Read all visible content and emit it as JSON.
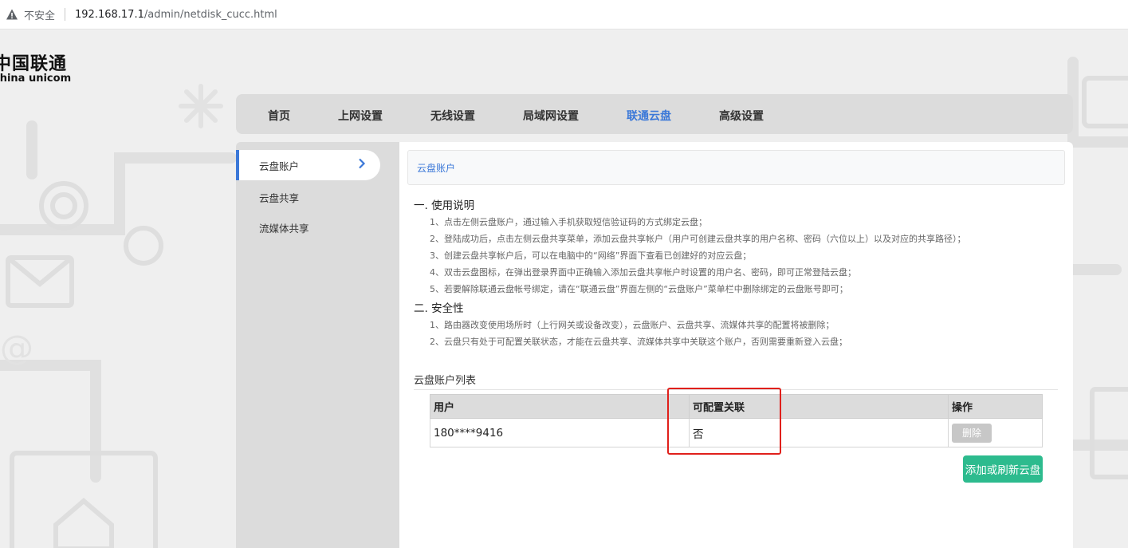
{
  "browser": {
    "security_label": "不安全",
    "url_host": "192.168.17.1",
    "url_path": "/admin/netdisk_cucc.html"
  },
  "logo": {
    "cn": "中国联通",
    "en": "china unicom"
  },
  "nav": {
    "tabs": [
      {
        "label": "首页",
        "active": false
      },
      {
        "label": "上网设置",
        "active": false
      },
      {
        "label": "无线设置",
        "active": false
      },
      {
        "label": "局域网设置",
        "active": false
      },
      {
        "label": "联通云盘",
        "active": true
      },
      {
        "label": "高级设置",
        "active": false
      }
    ]
  },
  "sidebar": {
    "items": [
      {
        "label": "云盘账户",
        "active": true
      },
      {
        "label": "云盘共享",
        "active": false
      },
      {
        "label": "流媒体共享",
        "active": false
      }
    ]
  },
  "main": {
    "breadcrumb": "云盘账户",
    "usage": {
      "title": "一. 使用说明",
      "lines": [
        "1、点击左侧云盘账户，通过输入手机获取短信验证码的方式绑定云盘；",
        "2、登陆成功后，点击左侧云盘共享菜单，添加云盘共享帐户（用户可创建云盘共享的用户名称、密码（六位以上）以及对应的共享路径）；",
        "3、创建云盘共享帐户后，可以在电脑中的“网络”界面下查看已创建好的对应云盘；",
        "4、双击云盘图标，在弹出登录界面中正确输入添加云盘共享帐户时设置的用户名、密码，即可正常登陆云盘；",
        "5、若要解除联通云盘帐号绑定，请在“联通云盘”界面左侧的“云盘账户”菜单栏中删除绑定的云盘账号即可；"
      ]
    },
    "security": {
      "title": "二. 安全性",
      "lines": [
        "1、路由器改变使用场所时（上行网关或设备改变），云盘账户、云盘共享、流媒体共享的配置将被删除；",
        "2、云盘只有处于可配置关联状态，才能在云盘共享、流媒体共享中关联这个账户，否则需要重新登入云盘；"
      ]
    },
    "list_title": "云盘账户列表",
    "table": {
      "headers": [
        "用户",
        "可配置关联",
        "操作"
      ],
      "rows": [
        {
          "user": "180****9416",
          "configurable": "否",
          "action": "删除"
        }
      ]
    },
    "add_button": "添加或刷新云盘"
  },
  "colors": {
    "accent": "#3b78d8",
    "add_button": "#2dbb8e",
    "highlight": "#e0201b"
  }
}
